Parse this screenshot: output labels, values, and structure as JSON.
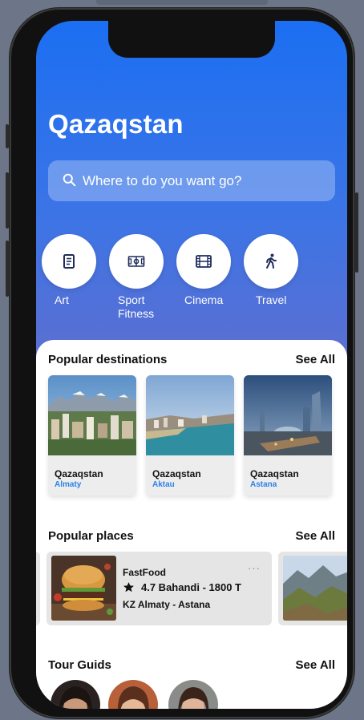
{
  "app": {
    "title": "Qazaqstan",
    "accent_color": "#1b6ff2",
    "link_color": "#2b82e8"
  },
  "search": {
    "placeholder": "Where to do you want go?",
    "icon": "search-icon"
  },
  "categories": [
    {
      "label": "Art",
      "icon": "document-icon"
    },
    {
      "label": "Sport\nFitness",
      "icon": "stadium-icon"
    },
    {
      "label": "Cinema",
      "icon": "film-icon"
    },
    {
      "label": "Travel",
      "icon": "walking-person-icon"
    }
  ],
  "popular_destinations": {
    "title": "Popular destinations",
    "see_all": "See All",
    "items": [
      {
        "name": "Qazaqstan",
        "city": "Almaty"
      },
      {
        "name": "Qazaqstan",
        "city": "Aktau"
      },
      {
        "name": "Qazaqstan",
        "city": "Astana"
      }
    ]
  },
  "popular_places": {
    "title": "Popular places",
    "see_all": "See All",
    "items": [
      {
        "type": "FastFood",
        "rating": "4.7 Bahandi - 1800 T",
        "route": "KZ Almaty - Astana",
        "more": "···"
      }
    ]
  },
  "tour_guides": {
    "title": "Tour Guids",
    "see_all": "See All"
  }
}
